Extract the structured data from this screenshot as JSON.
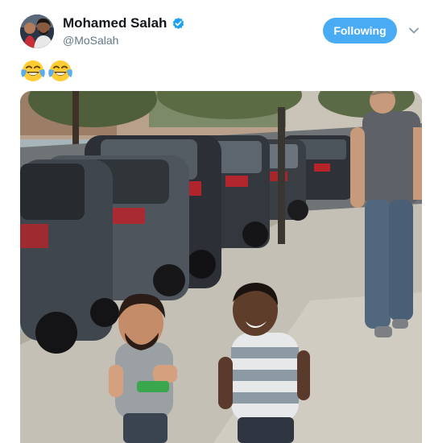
{
  "tweet": {
    "author": {
      "display_name": "Mohamed Salah",
      "handle": "@MoSalah",
      "verified": true,
      "avatar_icon": "profile-photo"
    },
    "follow_button_label": "Following",
    "more_icon": "chevron-down-icon",
    "text_emojis": [
      "face-with-tears-of-joy",
      "face-with-tears-of-joy"
    ],
    "media": {
      "type": "video",
      "content": "street-scene-with-parked-cars-two-children-and-a-walking-man"
    }
  },
  "colors": {
    "name": "#14171a",
    "secondary_text": "#657786",
    "follow_button_bg": "#4aabf5",
    "verified_badge": "#1da1f2"
  }
}
